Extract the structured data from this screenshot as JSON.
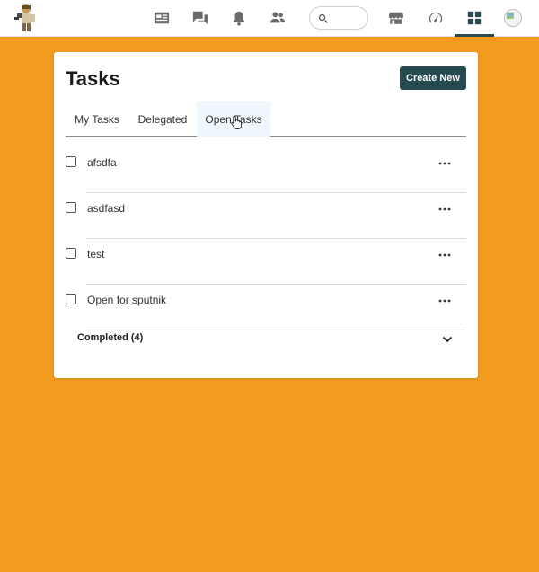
{
  "header": {
    "search_placeholder": "",
    "icons": [
      "news-icon",
      "chat-icon",
      "bell-icon",
      "people-icon",
      "search-icon",
      "store-icon",
      "gauge-icon",
      "apps-grid-icon",
      "avatar"
    ]
  },
  "card": {
    "title": "Tasks",
    "create_label": "Create New"
  },
  "tabs": [
    {
      "label": "My Tasks"
    },
    {
      "label": "Delegated"
    },
    {
      "label": "Open Tasks"
    }
  ],
  "tasks": [
    {
      "label": "afsdfa"
    },
    {
      "label": "asdfasd"
    },
    {
      "label": "test"
    },
    {
      "label": "Open for sputnik"
    }
  ],
  "completed": {
    "label": "Completed (4)"
  },
  "colors": {
    "background": "#F39C1F",
    "primary_button": "#254A50",
    "active_tab": "#EEF7FB"
  }
}
